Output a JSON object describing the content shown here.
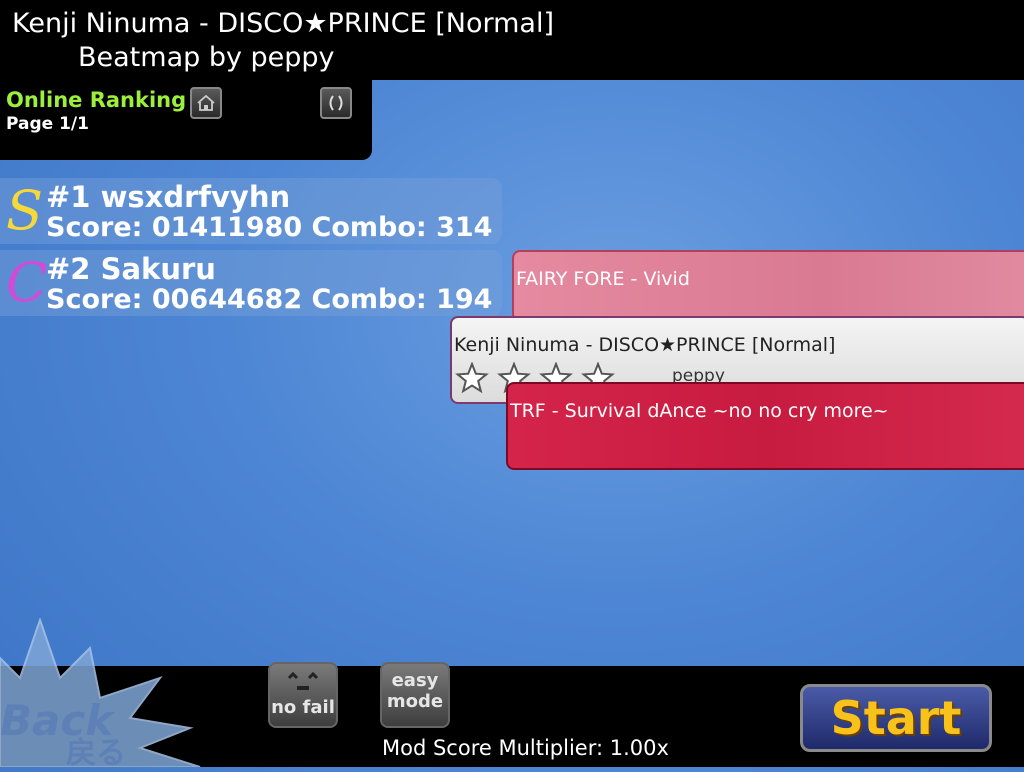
{
  "header": {
    "title": "Kenji Ninuma - DISCO★PRINCE [Normal]",
    "subtitle": "Beatmap by peppy"
  },
  "ranking": {
    "title": "Online Ranking",
    "page": "Page 1/1",
    "home_icon": "house-icon",
    "refresh_icon": "refresh-icon"
  },
  "scores": [
    {
      "grade": "S",
      "grade_color": "#f5d83a",
      "rank_line": "#1 wsxdrfvyhn",
      "score_line": "Score: 01411980 Combo: 314"
    },
    {
      "grade": "C",
      "grade_color": "#d24ad8",
      "rank_line": "#2 Sakuru",
      "score_line": "Score: 00644682 Combo: 194"
    }
  ],
  "songs": [
    {
      "title": "FAIRY FORE - Vivid"
    },
    {
      "title": "Kenji Ninuma - DISCO★PRINCE [Normal]",
      "creator": "peppy",
      "stars": 4
    },
    {
      "title": "TRF - Survival dAnce ~no no cry more~"
    }
  ],
  "bottom": {
    "back_label": "Back",
    "back_jp": "戻る",
    "nofail_label": "no fail",
    "easy_line1": "easy",
    "easy_line2": "mode",
    "start_label": "Start",
    "multiplier": "Mod Score Multiplier: 1.00x"
  }
}
